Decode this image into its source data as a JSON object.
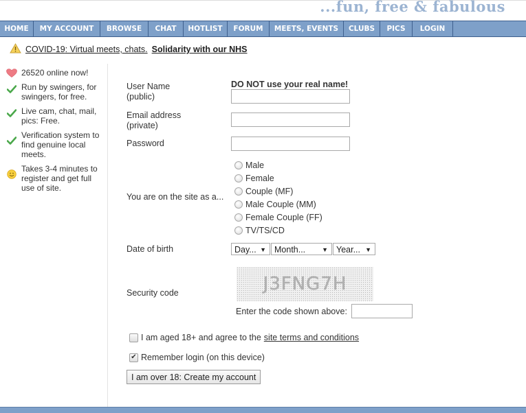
{
  "header": {
    "tagline": "...fun, free & fabulous"
  },
  "nav": {
    "items": [
      {
        "label": "HOME"
      },
      {
        "label": "MY ACCOUNT"
      },
      {
        "label": "BROWSE"
      },
      {
        "label": "CHAT"
      },
      {
        "label": "HOTLIST"
      },
      {
        "label": "FORUM"
      },
      {
        "label": "MEETS, EVENTS"
      },
      {
        "label": "CLUBS"
      },
      {
        "label": "PICS"
      },
      {
        "label": "LOGIN"
      }
    ]
  },
  "notice": {
    "icon": "warning-icon",
    "link_prefix": "COVID-19",
    "link_text": ": Virtual meets, chats.",
    "bold_text": "Solidarity with our NHS"
  },
  "sidebar": {
    "items": [
      {
        "icon": "heart-icon",
        "text": "26520 online now!"
      },
      {
        "icon": "check-icon",
        "text": "Run by swingers, for swingers, for free."
      },
      {
        "icon": "check-icon",
        "text": "Live cam, chat, mail, pics: Free."
      },
      {
        "icon": "check-icon",
        "text": "Verification system to find genuine local meets."
      },
      {
        "icon": "smiley-icon",
        "text": "Takes 3-4 minutes to register and get full use of site."
      }
    ]
  },
  "form": {
    "username": {
      "label": "User Name",
      "sublabel": "(public)",
      "hint": "DO NOT use your real name!",
      "value": ""
    },
    "email": {
      "label": "Email address",
      "sublabel": "(private)",
      "value": ""
    },
    "password": {
      "label": "Password",
      "value": ""
    },
    "gender": {
      "label": "You are on the site as a...",
      "options": [
        "Male",
        "Female",
        "Couple (MF)",
        "Male Couple (MM)",
        "Female Couple (FF)",
        "TV/TS/CD"
      ],
      "selected": null
    },
    "dob": {
      "label": "Date of birth",
      "day": "Day...",
      "month": "Month...",
      "year": "Year..."
    },
    "security": {
      "label": "Security code",
      "captcha_text": "J3FNG7H",
      "prompt": "Enter the code shown above:",
      "value": ""
    },
    "terms": {
      "checked": false,
      "text": "I am aged 18+ and agree to the",
      "link": "site terms and conditions"
    },
    "remember": {
      "checked": true,
      "text": "Remember login (on this device)"
    },
    "submit_label": "I am over 18: Create my account"
  },
  "colors": {
    "nav_bg": "#7ea0c9",
    "nav_border": "#3e5f8d",
    "tagline": "#9cb4d2",
    "check": "#4aa84a",
    "heart": "#e8707a"
  }
}
